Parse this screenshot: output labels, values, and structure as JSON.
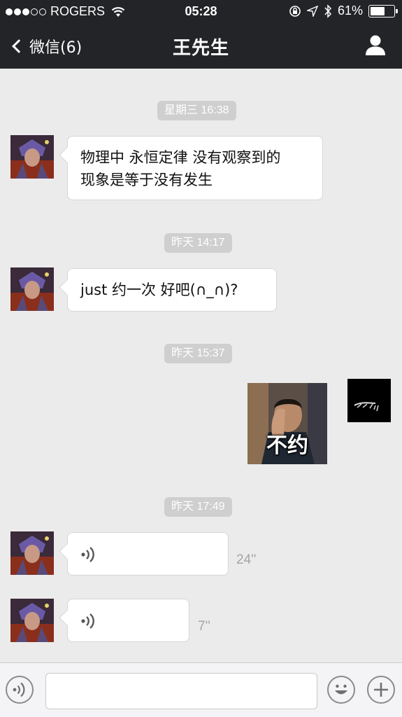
{
  "status_bar": {
    "carrier": "ROGERS",
    "time": "05:28",
    "battery_percent": "61%",
    "battery_level": 0.61
  },
  "nav": {
    "back_label": "微信(6)",
    "title": "王先生"
  },
  "messages": {
    "ts1": "星期三 16:38",
    "msg1_line1": "物理中 永恒定律 没有观察到的",
    "msg1_line2": "现象是等于没有发生",
    "ts2": "昨天 14:17",
    "msg2": "just 约一次 好吧(∩_∩)?",
    "ts3": "昨天 15:37",
    "sticker_text": "不约",
    "ts4": "昨天 17:49",
    "voice1_duration": "24''",
    "voice2_duration": "7''"
  },
  "input": {
    "value": ""
  },
  "icons": {
    "voice_toggle": "voice-mode-icon",
    "emoji": "emoji-icon",
    "plus": "plus-icon",
    "profile": "profile-icon"
  }
}
